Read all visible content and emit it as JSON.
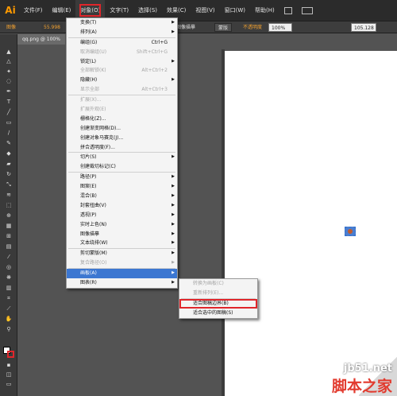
{
  "app": {
    "logo": "Ai"
  },
  "menubar": {
    "items": [
      "文件(F)",
      "编辑(E)",
      "对象(O)",
      "文字(T)",
      "选择(S)",
      "效果(C)",
      "视图(V)",
      "窗口(W)",
      "帮助(H)"
    ],
    "active_index": 2
  },
  "controlbar": {
    "left_label": "图像",
    "style_label": "图像描摹",
    "mask_label": "蒙版",
    "opacity_label": "不透明度",
    "opacity_value": "100%",
    "x_value": "105.128",
    "percent_value": "55.998"
  },
  "doctab": {
    "title": "qq.png @ 100%"
  },
  "object_menu": {
    "items": [
      {
        "label": "变换(T)",
        "arrow": true
      },
      {
        "label": "排列(A)",
        "arrow": true
      },
      {
        "sep": true
      },
      {
        "label": "编组(G)",
        "shortcut": "Ctrl+G"
      },
      {
        "label": "取消编组(U)",
        "shortcut": "Shift+Ctrl+G",
        "disabled": true
      },
      {
        "label": "锁定(L)",
        "arrow": true
      },
      {
        "label": "全部解锁(K)",
        "shortcut": "Alt+Ctrl+2",
        "disabled": true
      },
      {
        "label": "隐藏(H)",
        "arrow": true
      },
      {
        "label": "显示全部",
        "shortcut": "Alt+Ctrl+3",
        "disabled": true
      },
      {
        "sep": true
      },
      {
        "label": "扩展(X)...",
        "disabled": true
      },
      {
        "label": "扩展外观(E)",
        "disabled": true
      },
      {
        "label": "栅格化(Z)..."
      },
      {
        "label": "创建渐变网格(D)..."
      },
      {
        "label": "创建对象马赛克(J)..."
      },
      {
        "label": "拼合透明度(F)..."
      },
      {
        "sep": true
      },
      {
        "label": "切片(S)",
        "arrow": true
      },
      {
        "label": "创建裁切标记(C)"
      },
      {
        "sep": true
      },
      {
        "label": "路径(P)",
        "arrow": true
      },
      {
        "label": "图案(E)",
        "arrow": true
      },
      {
        "label": "混合(B)",
        "arrow": true
      },
      {
        "label": "封套扭曲(V)",
        "arrow": true
      },
      {
        "label": "透视(P)",
        "arrow": true
      },
      {
        "label": "实时上色(N)",
        "arrow": true
      },
      {
        "label": "图像描摹",
        "arrow": true
      },
      {
        "label": "文本绕排(W)",
        "arrow": true
      },
      {
        "sep": true
      },
      {
        "label": "剪切蒙版(M)",
        "arrow": true
      },
      {
        "label": "复合路径(O)",
        "arrow": true,
        "disabled": true
      },
      {
        "sep": true
      },
      {
        "label": "画板(A)",
        "arrow": true,
        "highlighted": true
      },
      {
        "label": "图表(R)",
        "arrow": true
      }
    ]
  },
  "artboard_submenu": {
    "items": [
      {
        "label": "转换为画板(C)",
        "disabled": true
      },
      {
        "label": "重新排列(E)...",
        "disabled": true
      },
      {
        "sep": true
      },
      {
        "label": "适合图稿边界(B)",
        "boxed": true
      },
      {
        "label": "适合选中的图稿(S)"
      }
    ]
  },
  "watermark": {
    "url": "jb51.net",
    "name": "脚本之家"
  }
}
